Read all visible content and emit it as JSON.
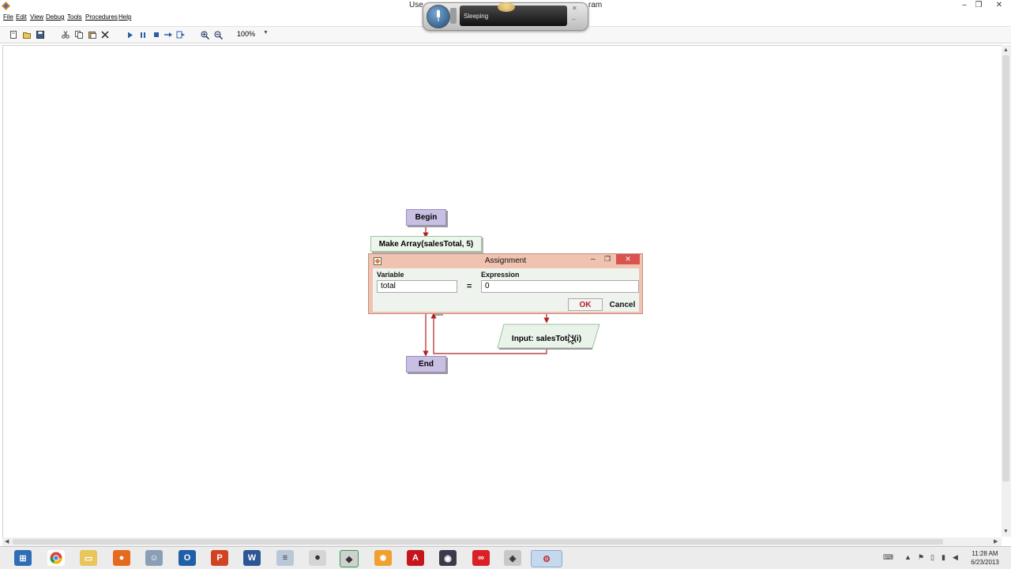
{
  "window": {
    "title_left": "Use",
    "title_right": "ram",
    "controls": [
      "–",
      "❐",
      "✕"
    ]
  },
  "menu": [
    "File",
    "Edit",
    "View",
    "Debug",
    "Tools",
    "Procedures",
    "Help"
  ],
  "toolbar": {
    "buttons": [
      "new-icon",
      "open-icon",
      "save-icon",
      "cut-icon",
      "copy-icon",
      "paste-icon",
      "delete-icon",
      "run-icon",
      "pause-icon",
      "stop-icon",
      "step-icon",
      "step-over-icon",
      "zoom-in-icon",
      "zoom-out-icon"
    ],
    "zoom": "100%"
  },
  "speech": {
    "status": "Sleeping"
  },
  "flowchart": {
    "begin": "Begin",
    "make_array": "Make Array(salesTotal, 5)",
    "input": "Input: salesTotal(i)",
    "end": "End"
  },
  "dialog": {
    "title": "Assignment",
    "variable_label": "Variable",
    "variable_value": "total",
    "equals": "=",
    "expression_label": "Expression",
    "expression_value": "0",
    "ok": "OK",
    "cancel": "Cancel"
  },
  "taskbar": {
    "apps": [
      "start",
      "chrome",
      "explorer",
      "firefox",
      "pidgin",
      "outlook",
      "powerpoint",
      "word",
      "notepad",
      "microphone",
      "app-green",
      "settings",
      "acrobat",
      "app-dark",
      "creative-cloud",
      "raptor-alt",
      "raptor"
    ],
    "time": "11:28 AM",
    "date": "6/23/2013"
  },
  "colors": {
    "terminal": "#c8bfe3",
    "process": "#ecf6ec",
    "arrow": "#b22222",
    "dialog_frame": "#f0c2b0",
    "ok_text": "#b22222"
  }
}
